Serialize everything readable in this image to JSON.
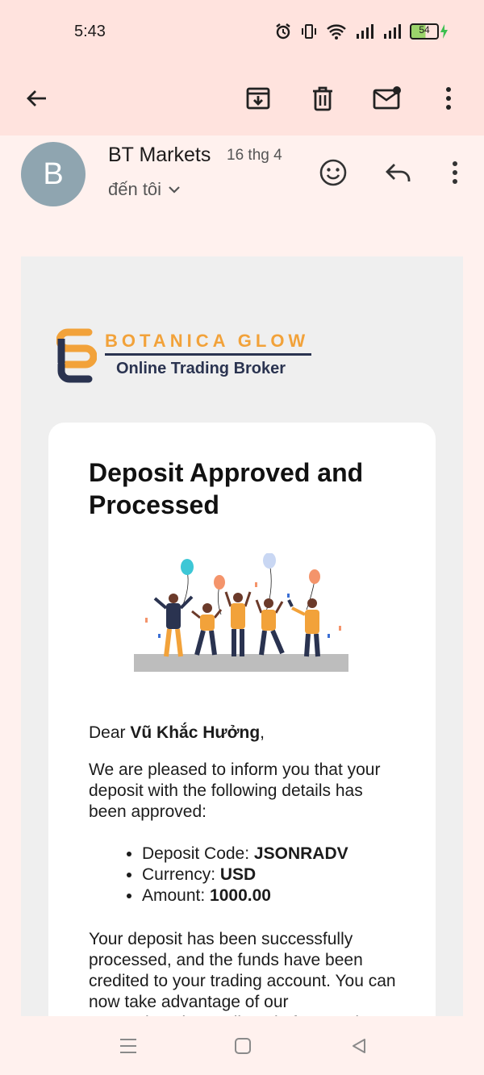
{
  "status_bar": {
    "time": "5:43",
    "battery": "54"
  },
  "email": {
    "avatar_letter": "B",
    "sender": "BT Markets",
    "date": "16 thg 4",
    "recipient": "đến tôi"
  },
  "content": {
    "logo_brand": "BOTANICA GLOW",
    "logo_tagline": "Online Trading Broker",
    "title": "Deposit Approved and Processed",
    "greeting_prefix": "Dear ",
    "recipient_name": "Vũ Khắc Hưởng",
    "greeting_suffix": ",",
    "intro": "We are pleased to inform you that your deposit with the following details has been approved:",
    "details": [
      {
        "label": "Deposit Code: ",
        "value": "JSONRADV"
      },
      {
        "label": "Currency: ",
        "value": "USD"
      },
      {
        "label": "Amount: ",
        "value": "1000.00"
      }
    ],
    "processed": "Your deposit has been successfully processed, and the funds have been credited to your trading account. You can now take advantage of our comprehensive trading platform and"
  },
  "colors": {
    "accent_orange": "#f2a23a",
    "navy": "#2a3350",
    "toolbar_bg": "#ffe3de"
  }
}
